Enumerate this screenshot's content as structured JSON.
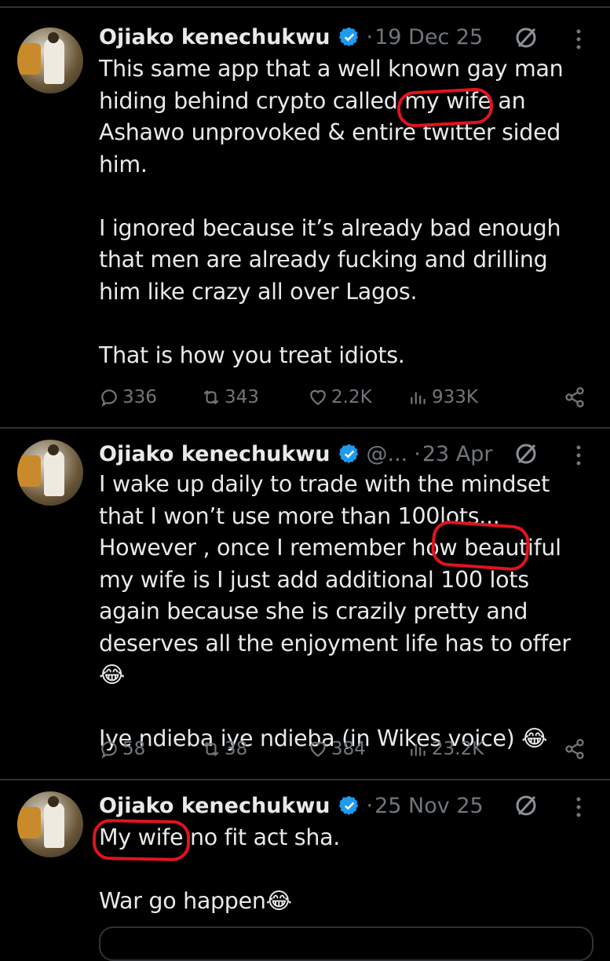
{
  "tweets": [
    {
      "name": "Ojiako kenechukwu",
      "handle": "",
      "dot": "·",
      "date": "19 Dec 25",
      "text": "This same app that a well known gay man hiding behind crypto called my wife an Ashawo unprovoked & entire twitter sided him.\n\nI ignored because it’s already bad enough that men are already fucking and drilling him like crazy all over Lagos.\n\nThat is how you treat idiots.",
      "replies": "336",
      "reposts": "343",
      "likes": "2.2K",
      "views": "933K"
    },
    {
      "name": "Ojiako kenechukwu",
      "handle": "@...",
      "dot": "·",
      "date": "23 Apr",
      "text": "I wake up daily to trade with the mindset that I won’t use more than 100lots... However , once I remember how beautiful my wife is I just add additional 100 lots again because she is crazily pretty and deserves all the enjoyment life has to offer😂\n\nIye ndieba iye ndieba (in Wikes voice) 😂",
      "replies": "58",
      "reposts": "38",
      "likes": "384",
      "views": "23.2K"
    },
    {
      "name": "Ojiako kenechukwu",
      "handle": "",
      "dot": "·",
      "date": "25 Nov 25",
      "text": "My wife no fit act sha.\n\nWar go happen😂"
    }
  ],
  "icons": {
    "verified": "verified-badge-icon",
    "grok": "grok-icon",
    "more": "more-dots-icon",
    "reply": "reply-icon",
    "repost": "repost-icon",
    "like": "heart-icon",
    "views": "views-icon",
    "share": "share-icon"
  },
  "colors": {
    "background": "#000000",
    "text": "#e7e9ea",
    "muted": "#71767b",
    "verified": "#1d9bf0",
    "annotation": "#e0141e"
  }
}
